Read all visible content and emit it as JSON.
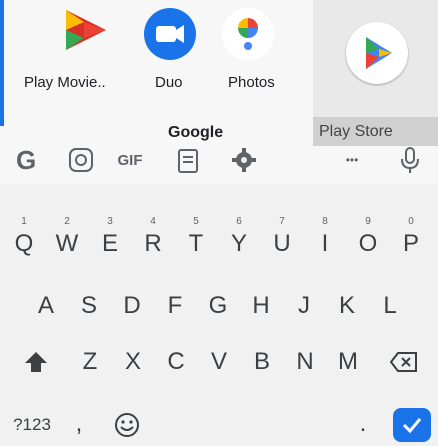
{
  "apps": {
    "items": [
      {
        "label": "Play Movie..",
        "icon": "play-movies-icon"
      },
      {
        "label": "Duo",
        "icon": "duo-icon"
      },
      {
        "label": "Photos",
        "icon": "photos-icon"
      }
    ],
    "google_label": "Google",
    "playstore_label": "Play Store"
  },
  "toolbar": {
    "items": [
      "google-g-icon",
      "sticker-icon",
      "gif-icon",
      "clipboard-icon",
      "settings-icon",
      "more-icon",
      "mic-icon"
    ],
    "gif_label": "GIF",
    "more_label": "•••"
  },
  "keyboard": {
    "row1": [
      "Q",
      "W",
      "E",
      "R",
      "T",
      "Y",
      "U",
      "I",
      "O",
      "P"
    ],
    "row1_hints": [
      "1",
      "2",
      "3",
      "4",
      "5",
      "6",
      "7",
      "8",
      "9",
      "0"
    ],
    "row2": [
      "A",
      "S",
      "D",
      "F",
      "G",
      "H",
      "J",
      "K",
      "L"
    ],
    "row3": [
      "Z",
      "X",
      "C",
      "V",
      "B",
      "N",
      "M"
    ],
    "symbols_label": "?123",
    "comma_label": ",",
    "period_label": "."
  },
  "colors": {
    "accent": "#1a73e8",
    "key_text": "#3c4043",
    "background": "#f1f1f1"
  }
}
